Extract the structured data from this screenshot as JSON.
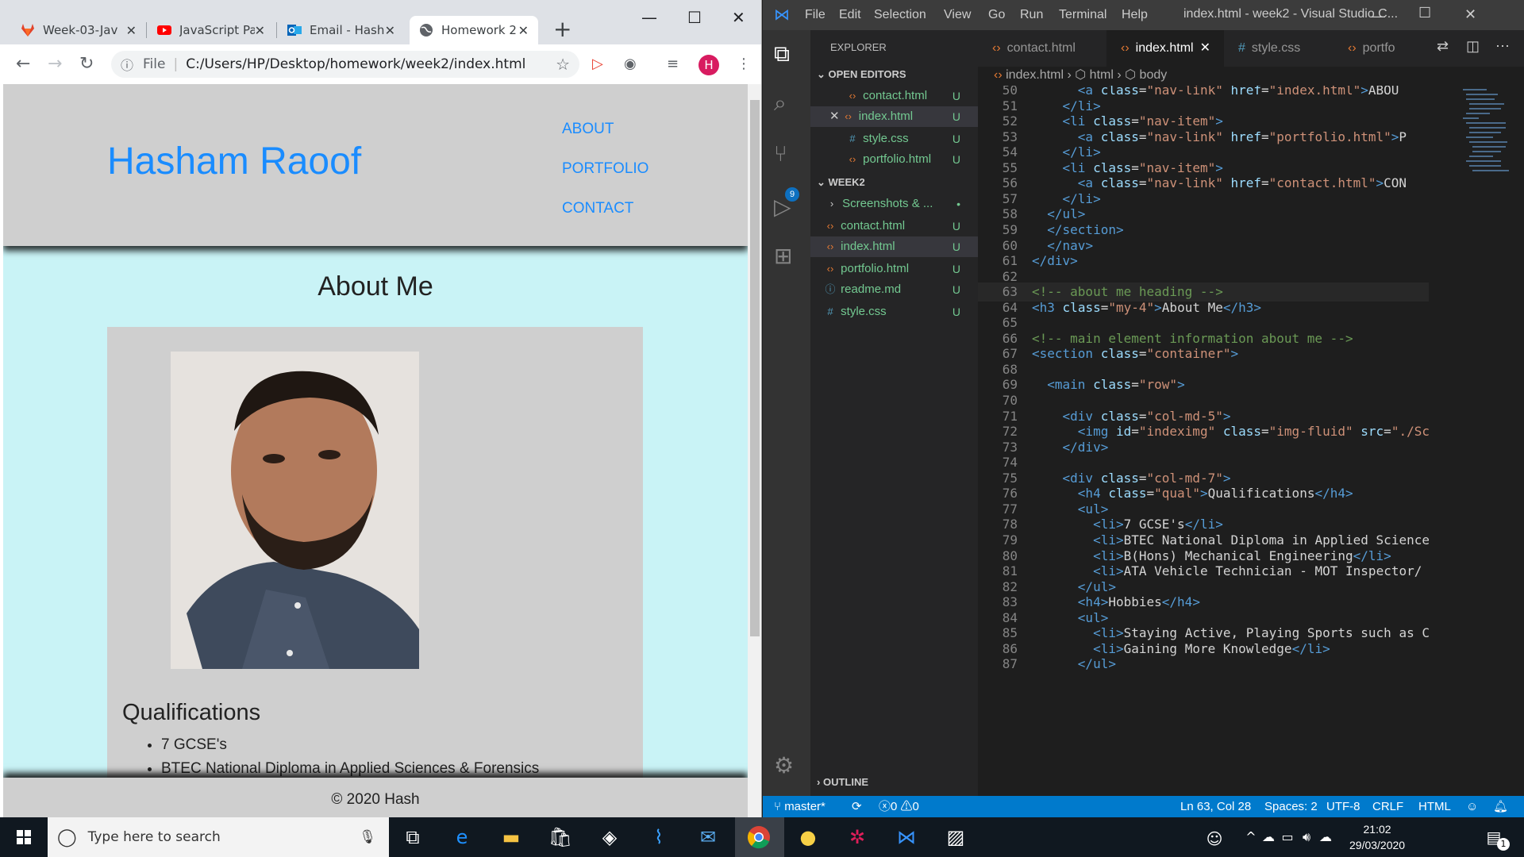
{
  "chrome": {
    "tabs": [
      {
        "label": "Week-03-Jav",
        "icon": "gitlab-icon",
        "active": false
      },
      {
        "label": "JavaScript Pa",
        "icon": "youtube-icon",
        "active": false
      },
      {
        "label": "Email - Hash",
        "icon": "outlook-icon",
        "active": false
      },
      {
        "label": "Homework 2",
        "icon": "globe-icon",
        "active": true
      }
    ],
    "address": {
      "scheme_label": "File",
      "url": "C:/Users/HP/Desktop/homework/week2/index.html"
    },
    "profile_initial": "H"
  },
  "site": {
    "name": "Hasham Raoof",
    "nav": [
      "ABOUT",
      "PORTFOLIO",
      "CONTACT"
    ],
    "about_heading": "About Me",
    "qualifications_heading": "Qualifications",
    "qualifications": [
      "7 GCSE's",
      "BTEC National Diploma in Applied Sciences & Forensics"
    ],
    "footer": "© 2020 Hash",
    "colors": {
      "brand": "#1a8cff",
      "header_bg": "#cfcfcf",
      "page_bg": "#c9f3f6"
    }
  },
  "vscode": {
    "menu": [
      "File",
      "Edit",
      "Selection",
      "View",
      "Go",
      "Run",
      "Terminal",
      "Help"
    ],
    "window_title": "index.html - week2 - Visual Studio C...",
    "explorer_title": "EXPLORER",
    "open_editors_label": "OPEN EDITORS",
    "open_editors": [
      {
        "name": "contact.html",
        "type": "html",
        "git": "U"
      },
      {
        "name": "index.html",
        "type": "html",
        "git": "U"
      },
      {
        "name": "style.css",
        "type": "css",
        "git": "U"
      },
      {
        "name": "portfolio.html",
        "type": "html",
        "git": "U"
      }
    ],
    "folder_label": "WEEK2",
    "folder_items": [
      {
        "name": "Screenshots & ...",
        "type": "folder",
        "git": "•"
      },
      {
        "name": "contact.html",
        "type": "html",
        "git": "U"
      },
      {
        "name": "index.html",
        "type": "html",
        "git": "U"
      },
      {
        "name": "portfolio.html",
        "type": "html",
        "git": "U"
      },
      {
        "name": "readme.md",
        "type": "md",
        "git": "U"
      },
      {
        "name": "style.css",
        "type": "css",
        "git": "U"
      }
    ],
    "outline_label": "OUTLINE",
    "editor_tabs": [
      "contact.html",
      "index.html",
      "style.css",
      "portfo"
    ],
    "breadcrumbs": [
      "index.html",
      "html",
      "body"
    ],
    "source_control_count": "9",
    "code_lines": [
      {
        "n": "50",
        "code": "      <a class=\"nav-link\" href=\"index.html\">ABOU"
      },
      {
        "n": "51",
        "code": "    </li>"
      },
      {
        "n": "52",
        "code": "    <li class=\"nav-item\">"
      },
      {
        "n": "53",
        "code": "      <a class=\"nav-link\" href=\"portfolio.html\">P"
      },
      {
        "n": "54",
        "code": "    </li>"
      },
      {
        "n": "55",
        "code": "    <li class=\"nav-item\">"
      },
      {
        "n": "56",
        "code": "      <a class=\"nav-link\" href=\"contact.html\">CON"
      },
      {
        "n": "57",
        "code": "    </li>"
      },
      {
        "n": "58",
        "code": "  </ul>"
      },
      {
        "n": "59",
        "code": "  </section>"
      },
      {
        "n": "60",
        "code": "  </nav>"
      },
      {
        "n": "61",
        "code": "</div>"
      },
      {
        "n": "62",
        "code": ""
      },
      {
        "n": "63",
        "code": "<!-- about me heading -->"
      },
      {
        "n": "64",
        "code": "<h3 class=\"my-4\">About Me</h3>"
      },
      {
        "n": "65",
        "code": ""
      },
      {
        "n": "66",
        "code": "<!-- main element information about me -->"
      },
      {
        "n": "67",
        "code": "<section class=\"container\">"
      },
      {
        "n": "68",
        "code": ""
      },
      {
        "n": "69",
        "code": "  <main class=\"row\">"
      },
      {
        "n": "70",
        "code": ""
      },
      {
        "n": "71",
        "code": "    <div class=\"col-md-5\">"
      },
      {
        "n": "72",
        "code": "      <img id=\"indeximg\" class=\"img-fluid\" src=\"./Sc"
      },
      {
        "n": "73",
        "code": "    </div>"
      },
      {
        "n": "74",
        "code": ""
      },
      {
        "n": "75",
        "code": "    <div class=\"col-md-7\">"
      },
      {
        "n": "76",
        "code": "      <h4 class=\"qual\">Qualifications</h4>"
      },
      {
        "n": "77",
        "code": "      <ul>"
      },
      {
        "n": "78",
        "code": "        <li>7 GCSE's</li>"
      },
      {
        "n": "79",
        "code": "        <li>BTEC National Diploma in Applied Science"
      },
      {
        "n": "80",
        "code": "        <li>B(Hons) Mechanical Engineering</li>"
      },
      {
        "n": "81",
        "code": "        <li>ATA Vehicle Technician - MOT Inspector</"
      },
      {
        "n": "82",
        "code": "      </ul>"
      },
      {
        "n": "83",
        "code": "      <h4>Hobbies</h4>"
      },
      {
        "n": "84",
        "code": "      <ul>"
      },
      {
        "n": "85",
        "code": "        <li>Staying Active, Playing Sports such as C"
      },
      {
        "n": "86",
        "code": "        <li>Gaining More Knowledge</li>"
      },
      {
        "n": "87",
        "code": "      </ul>"
      }
    ],
    "status": {
      "branch": "master*",
      "errors": "0",
      "warnings": "0",
      "position": "Ln 63, Col 28",
      "spaces": "Spaces: 2",
      "encoding": "UTF-8",
      "eol": "CRLF",
      "language": "HTML"
    },
    "colors": {
      "statusbar": "#007acc",
      "git_untracked": "#73c991"
    }
  },
  "taskbar": {
    "search_placeholder": "Type here to search",
    "time": "21:02",
    "date": "29/03/2020",
    "notification_count": "1"
  }
}
